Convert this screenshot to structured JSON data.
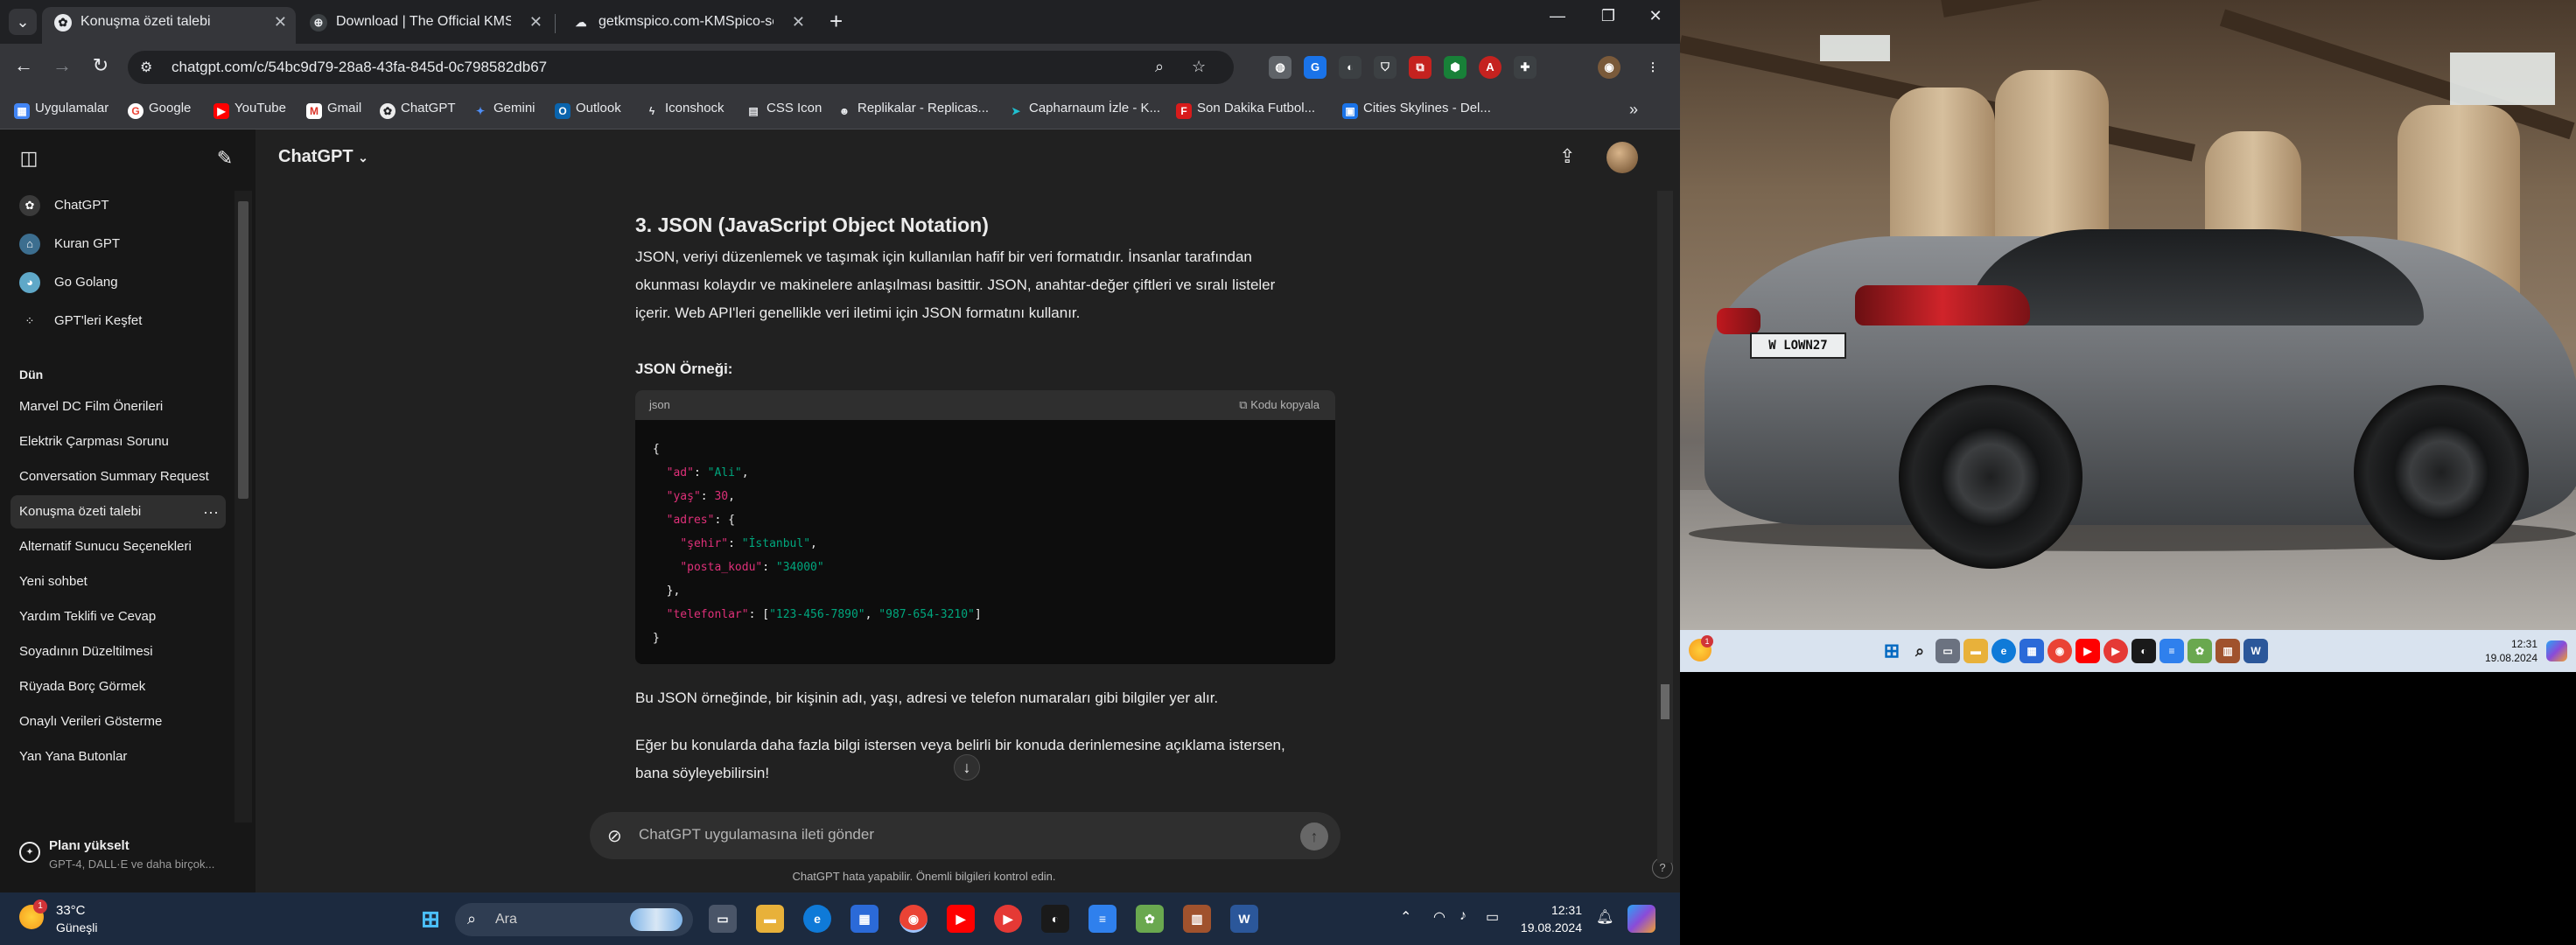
{
  "browser": {
    "tabs": [
      {
        "title": "Konuşma özeti talebi",
        "favicon": "chatgpt-logo",
        "active": true
      },
      {
        "title": "Download | The Official KMSpico",
        "favicon": "globe",
        "active": false
      },
      {
        "title": "getkmspico.com-KMSpico-setu",
        "favicon": "cloud-download",
        "active": false
      }
    ],
    "url": "chatgpt.com/c/54bc9d79-28a8-43fa-845d-0c798582db67",
    "bookmarks": [
      {
        "label": "Uygulamalar",
        "icon": "apps-grid",
        "color": "#4285f4"
      },
      {
        "label": "Google",
        "icon": "google-g",
        "color": "#ea4335"
      },
      {
        "label": "YouTube",
        "icon": "youtube-play",
        "color": "#ff0000"
      },
      {
        "label": "Gmail",
        "icon": "gmail-m",
        "color": "#d93025"
      },
      {
        "label": "ChatGPT",
        "icon": "chatgpt-logo",
        "color": "#ececec"
      },
      {
        "label": "Gemini",
        "icon": "gemini-star",
        "color": "#4e8ef7"
      },
      {
        "label": "Outlook",
        "icon": "outlook-o",
        "color": "#0a64ad"
      },
      {
        "label": "Iconshock",
        "icon": "lightning",
        "color": "#e8eaed"
      },
      {
        "label": "CSS Icon",
        "icon": "film-clapper",
        "color": "#e8eaed"
      },
      {
        "label": "Replikalar - Replicas...",
        "icon": "mask",
        "color": "#e8eaed"
      },
      {
        "label": "Capharnaum İzle - K...",
        "icon": "arrow-cyan",
        "color": "#20c0d0"
      },
      {
        "label": "Son Dakika Futbol...",
        "icon": "fotomac-f",
        "color": "#d81b1b"
      },
      {
        "label": "Cities Skylines - Del...",
        "icon": "bookmark-blue",
        "color": "#1a73e8"
      }
    ]
  },
  "sidebar": {
    "gpts": [
      {
        "label": "ChatGPT",
        "icon": "chatgpt-logo",
        "color": "#3a3a3a"
      },
      {
        "label": "Kuran GPT",
        "icon": "mosque",
        "color": "#3c6e8f"
      },
      {
        "label": "Go Golang",
        "icon": "gopher",
        "color": "#5fa8c8"
      },
      {
        "label": "GPT'leri Keşfet",
        "icon": "grid-dots",
        "color": "#171717"
      }
    ],
    "section_label": "Dün",
    "history": [
      "Marvel DC Film Önerileri",
      "Elektrik Çarpması Sorunu",
      "Conversation Summary Request",
      "Konuşma özeti talebi",
      "Alternatif Sunucu Seçenekleri",
      "Yeni sohbet",
      "Yardım Teklifi ve Cevap",
      "Soyadının Düzeltilmesi",
      "Rüyada Borç Görmek",
      "Onaylı Verileri Gösterme",
      "Yan Yana Butonlar"
    ],
    "upgrade": {
      "title": "Planı yükselt",
      "subtitle": "GPT-4, DALL·E ve daha birçok..."
    }
  },
  "chat": {
    "model": "ChatGPT",
    "heading": "3. JSON (JavaScript Object Notation)",
    "para1_l1": "JSON, veriyi düzenlemek ve taşımak için kullanılan hafif bir veri formatıdır. İnsanlar tarafından",
    "para1_l2": "okunması kolaydır ve makinelere anlaşılması basittir. JSON, anahtar-değer çiftleri ve sıralı listeler",
    "para1_l3": "içerir. Web API'leri genellikle veri iletimi için JSON formatını kullanır.",
    "example_title": "JSON Örneği:",
    "code_lang": "json",
    "copy_label": "Kodu kopyala",
    "code": {
      "open": "{",
      "ad_key": "\"ad\"",
      "ad_val": "\"Ali\"",
      "yas_key": "\"yaş\"",
      "yas_val": "30",
      "adres_key": "\"adres\"",
      "sehir_key": "\"şehir\"",
      "sehir_val": "\"İstanbul\"",
      "posta_key": "\"posta_kodu\"",
      "posta_val": "\"34000\"",
      "close_inner": "},",
      "tel_key": "\"telefonlar\"",
      "tel_1": "\"123-456-7890\"",
      "tel_2": "\"987-654-3210\"",
      "close": "}"
    },
    "para2": "Bu JSON örneğinde, bir kişinin adı, yaşı, adresi ve telefon numaraları gibi bilgiler yer alır.",
    "para3_l1": "Eğer bu konularda daha fazla bilgi istersen veya belirli bir konuda derinlemesine açıklama istersen,",
    "para3_l2": "bana söyleyebilirsin!",
    "input_placeholder": "ChatGPT uygulamasına ileti gönder",
    "disclaimer": "ChatGPT hata yapabilir. Önemli bilgileri kontrol edin."
  },
  "taskbar_left": {
    "temperature": "33°C",
    "condition": "Güneşli",
    "weather_badge": "1",
    "search_label": "Ara",
    "time": "12:31",
    "date": "19.08.2024"
  },
  "right_screen": {
    "plate_text": "W LOWN27",
    "time": "12:31",
    "date": "19.08.2024"
  }
}
